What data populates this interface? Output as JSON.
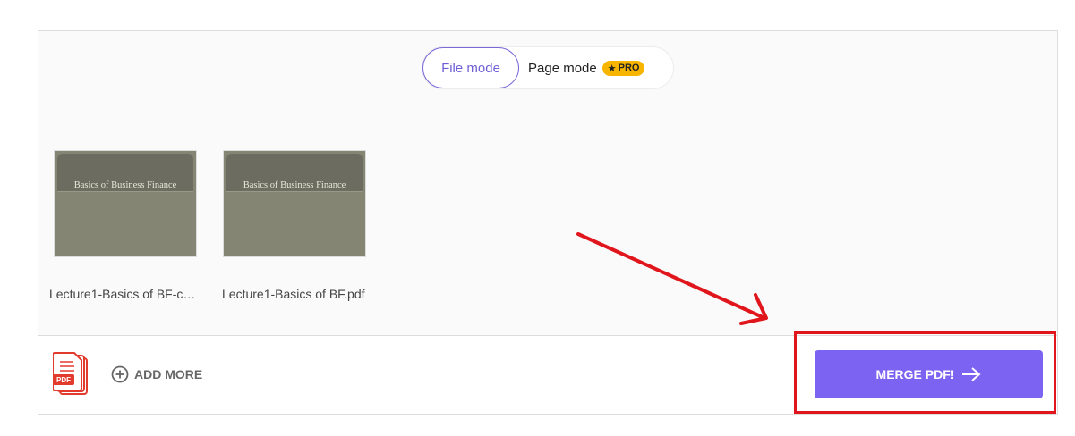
{
  "mode_toggle": {
    "file_mode_label": "File mode",
    "page_mode_label": "Page mode",
    "pro_badge_label": "PRO",
    "selected": "File mode"
  },
  "files": [
    {
      "name": "Lecture1-Basics of BF-c…",
      "thumbnail_title": "Basics of Business Finance"
    },
    {
      "name": "Lecture1-Basics of BF.pdf",
      "thumbnail_title": "Basics of Business Finance"
    }
  ],
  "bottom_bar": {
    "pdf_icon_label": "PDF",
    "add_more_label": "ADD MORE",
    "merge_label": "MERGE PDF!"
  },
  "annotation": {
    "arrow_color": "#e0161c",
    "highlight_color": "#e0161c"
  },
  "colors": {
    "accent": "#7c63f2",
    "pro_badge": "#f7b500",
    "pdf_red": "#e23b2e"
  }
}
